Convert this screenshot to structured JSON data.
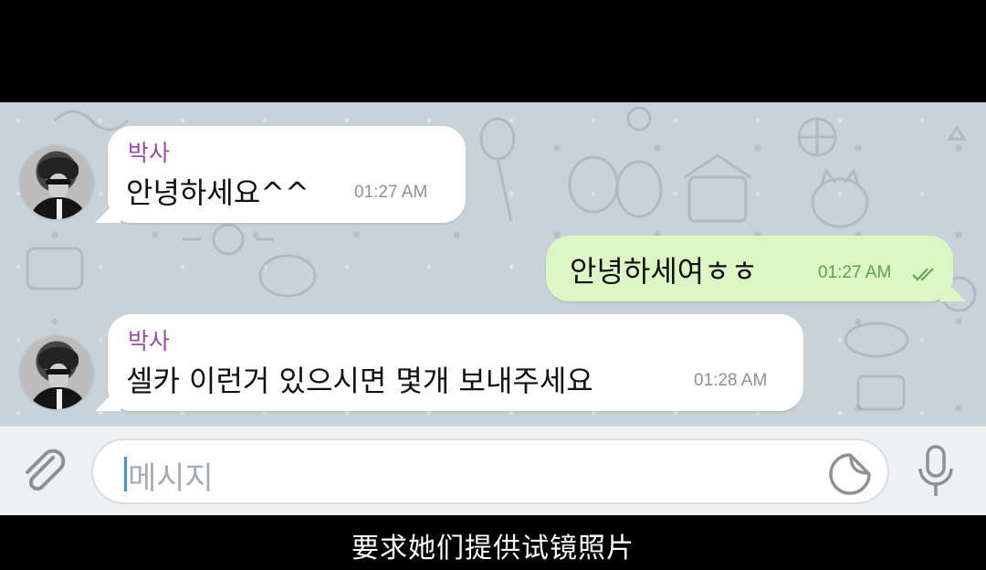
{
  "messages": [
    {
      "sender": "박사",
      "text": "안녕하세요^^",
      "time": "01:27 AM",
      "direction": "incoming"
    },
    {
      "text": "안녕하세여ㅎㅎ",
      "time": "01:27 AM",
      "direction": "outgoing",
      "read": true
    },
    {
      "sender": "박사",
      "text": "셀카 이런거 있으시면 몇개 보내주세요",
      "time": "01:28 AM",
      "direction": "incoming"
    }
  ],
  "composer": {
    "placeholder": "메시지",
    "attach_icon": "paperclip-icon",
    "sticker_icon": "sticker-icon",
    "mic_icon": "microphone-icon"
  },
  "subtitle": "要求她们提供试镜照片",
  "colors": {
    "sender_name": "#9a4aa6",
    "outgoing_bubble": "#dcf6c4",
    "incoming_bubble": "#ffffff",
    "read_ticks": "#57a54c",
    "chat_background": "#c9d2d8"
  }
}
